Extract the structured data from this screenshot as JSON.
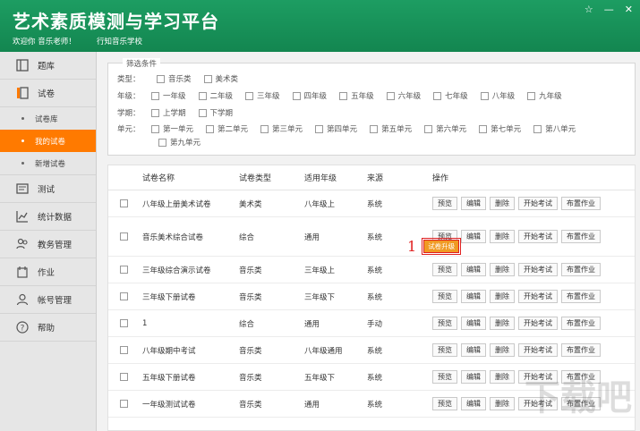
{
  "app": {
    "title": "艺术素质模测与学习平台",
    "welcome": "欢迎你 音乐老师！",
    "school": "行知音乐学校"
  },
  "window_controls": {
    "skin": "☆",
    "minimize": "—",
    "close": "✕"
  },
  "sidebar": {
    "items": [
      {
        "label": "题库",
        "icon": "book-icon"
      },
      {
        "label": "试卷",
        "icon": "document-icon"
      },
      {
        "label": "测试",
        "icon": "test-icon"
      },
      {
        "label": "统计数据",
        "icon": "chart-icon"
      },
      {
        "label": "教务管理",
        "icon": "users-icon"
      },
      {
        "label": "作业",
        "icon": "homework-icon"
      },
      {
        "label": "帐号管理",
        "icon": "account-icon"
      },
      {
        "label": "帮助",
        "icon": "help-icon"
      }
    ],
    "sub_items": [
      "试卷库",
      "我的试卷",
      "新增试卷"
    ],
    "active_sub": "我的试卷",
    "active_color": "#ff7a00"
  },
  "filter": {
    "legend": "筛选条件",
    "type_label": "类型：",
    "types": [
      "音乐类",
      "美术类"
    ],
    "grade_label": "年级：",
    "grades": [
      "一年级",
      "二年级",
      "三年级",
      "四年级",
      "五年级",
      "六年级",
      "七年级",
      "八年级",
      "九年级"
    ],
    "term_label": "学期：",
    "terms": [
      "上学期",
      "下学期"
    ],
    "unit_label": "单元：",
    "units": [
      "第一单元",
      "第二单元",
      "第三单元",
      "第四单元",
      "第五单元",
      "第六单元",
      "第七单元",
      "第八单元",
      "第九单元"
    ]
  },
  "table": {
    "headers": [
      "试卷名称",
      "试卷类型",
      "适用年级",
      "来源",
      "操作"
    ],
    "buttons": [
      "预览",
      "编辑",
      "删除",
      "开始考试",
      "布置作业"
    ],
    "rows": [
      {
        "name": "八年级上册美术试卷",
        "type": "美术类",
        "grade": "八年级上",
        "source": "系统"
      },
      {
        "name": "音乐美术综合试卷",
        "type": "综合",
        "grade": "通用",
        "source": "系统"
      },
      {
        "name": "三年级综合演示试卷",
        "type": "音乐类",
        "grade": "三年级上",
        "source": "系统"
      },
      {
        "name": "三年级下册试卷",
        "type": "音乐类",
        "grade": "三年级下",
        "source": "系统"
      },
      {
        "name": "1",
        "type": "综合",
        "grade": "通用",
        "source": "手动"
      },
      {
        "name": "八年级期中考试",
        "type": "音乐类",
        "grade": "八年级通用",
        "source": "系统"
      },
      {
        "name": "五年级下册试卷",
        "type": "音乐类",
        "grade": "五年级下",
        "source": "系统"
      },
      {
        "name": "一年级测试试卷",
        "type": "音乐类",
        "grade": "通用",
        "source": "系统"
      }
    ]
  },
  "annotation": {
    "number": "1",
    "upgrade_label": "试卷升级"
  },
  "watermark": "下载吧"
}
